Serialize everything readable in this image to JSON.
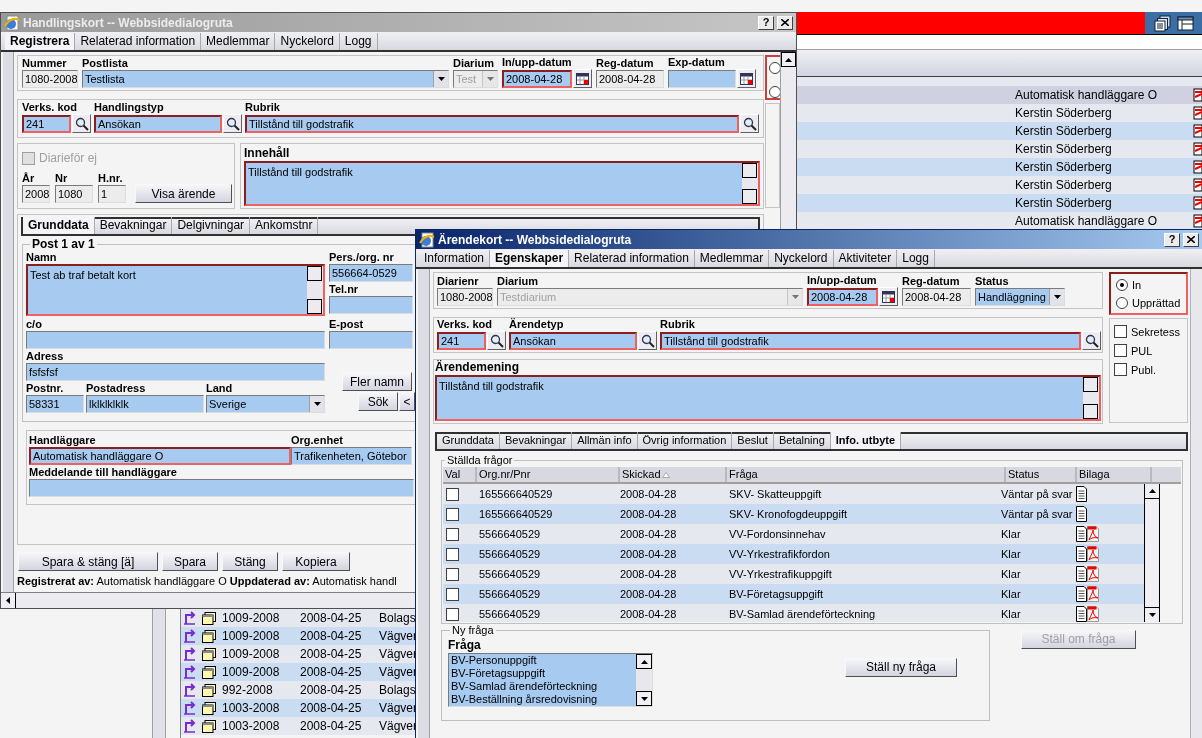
{
  "handler_list": {
    "rows": [
      {
        "name": "Automatisk handläggare O",
        "selected": true
      },
      {
        "name": "Kerstin Söderberg",
        "selected": false
      },
      {
        "name": "Kerstin Söderberg",
        "selected": false
      },
      {
        "name": "Kerstin Söderberg",
        "selected": false
      },
      {
        "name": "Kerstin Söderberg",
        "selected": false
      },
      {
        "name": "Kerstin Söderberg",
        "selected": false
      },
      {
        "name": "Kerstin Söderberg",
        "selected": false
      },
      {
        "name": "Automatisk handläggare O",
        "selected": false
      }
    ]
  },
  "case_list": {
    "rows": [
      {
        "case_number": "1009-2008",
        "date": "2008-04-25",
        "column_3": "Bolags"
      },
      {
        "case_number": "1009-2008",
        "date": "2008-04-25",
        "column_3": "Vägver"
      },
      {
        "case_number": "1009-2008",
        "date": "2008-04-25",
        "column_3": "Vägver"
      },
      {
        "case_number": "1009-2008",
        "date": "2008-04-25",
        "column_3": "Vägver"
      },
      {
        "case_number": "992-2008",
        "date": "2008-04-25",
        "column_3": "Bolags"
      },
      {
        "case_number": "1003-2008",
        "date": "2008-04-25",
        "column_3": "Vägver"
      },
      {
        "case_number": "1003-2008",
        "date": "2008-04-25",
        "column_3": "Vägver"
      }
    ]
  },
  "handlingskort": {
    "title": "Handlingskort -- Webbsidedialogruta",
    "help": "?",
    "tabs": [
      {
        "label": "Registrera",
        "selected": true
      },
      {
        "label": "Relaterad information",
        "selected": false
      },
      {
        "label": "Medlemmar",
        "selected": false
      },
      {
        "label": "Nyckelord",
        "selected": false
      },
      {
        "label": "Logg",
        "selected": false
      }
    ],
    "header_fields": [
      {
        "label": "Nummer",
        "value": "1080-2008",
        "kind": "readonly",
        "required": false
      },
      {
        "label": "Postlista",
        "value": "Testlista",
        "kind": "select",
        "required": false
      },
      {
        "label": "Diarium",
        "value": "Test",
        "kind": "disabled-select",
        "required": false
      },
      {
        "label": "In/upp-datum",
        "value": "2008-04-28",
        "kind": "date",
        "required": true
      },
      {
        "label": "Reg-datum",
        "value": "2008-04-28",
        "kind": "readonly",
        "required": false
      },
      {
        "label": "Exp-datum",
        "kind": "date",
        "required": false
      }
    ],
    "lookup_fields": [
      {
        "label": "Verks. kod",
        "value": "241",
        "kind": "lookup",
        "required": true
      },
      {
        "label": "Handlingstyp",
        "value": "Ansökan",
        "kind": "lookup",
        "required": true
      },
      {
        "label": "Rubrik",
        "value": "Tillstånd till godstrafik",
        "kind": "lookup",
        "required": true
      }
    ],
    "no_register": {
      "label": "Diarieför ej",
      "checked": false,
      "disabled": true
    },
    "number_fields": [
      {
        "label": "År",
        "value": "2008",
        "kind": "readonly",
        "required": false
      },
      {
        "label": "Nr",
        "value": "1080",
        "kind": "readonly",
        "required": false
      },
      {
        "label": "H.nr.",
        "value": "1",
        "kind": "readonly",
        "required": false
      }
    ],
    "show_case_button": "Visa ärende",
    "content": {
      "label": "Innehåll",
      "value": "Tillstånd till godstrafik",
      "kind": "textarea",
      "required": true
    },
    "sub_tabs": [
      {
        "label": "Grunddata",
        "selected": true
      },
      {
        "label": "Bevakningar",
        "selected": false
      },
      {
        "label": "Delgivningar",
        "selected": false
      },
      {
        "label": "Ankomstnr",
        "selected": false
      }
    ],
    "post": {
      "legend": "Post 1 av 1",
      "name": {
        "label": "Namn",
        "value": "Test ab traf betalt kort",
        "kind": "textarea",
        "required": true
      },
      "org_nr": {
        "label": "Pers./org. nr",
        "value": "556664-0529",
        "kind": "text",
        "required": false
      },
      "phone": {
        "label": "Tel.nr",
        "kind": "text",
        "required": false
      },
      "co": {
        "label": "c/o",
        "kind": "text",
        "required": false
      },
      "email": {
        "label": "E-post",
        "kind": "text",
        "required": false
      },
      "address": {
        "label": "Adress",
        "value": "fsfsfsf",
        "kind": "text",
        "required": false
      },
      "postal_code": {
        "label": "Postnr.",
        "value": "58331",
        "kind": "text",
        "required": false
      },
      "city": {
        "label": "Postadress",
        "value": "lklklklklk",
        "kind": "text",
        "required": false
      },
      "country": {
        "label": "Land",
        "value": "Sverige",
        "kind": "select",
        "required": false
      },
      "more_names_button": "Fler namn",
      "search_button": "Sök",
      "previous_button": "<"
    },
    "handler": {
      "label": "Handläggare",
      "value": "Automatisk handläggare O",
      "kind": "text",
      "required": true
    },
    "org_unit": {
      "label": "Org.enhet",
      "value": "Trafikenheten, Götebor",
      "kind": "text",
      "required": false
    },
    "message": {
      "label": "Meddelande till handläggare",
      "kind": "text",
      "required": false
    },
    "buttons": [
      "Spara & stäng [ä]",
      "Spara",
      "Stäng",
      "Kopiera"
    ],
    "footer": "**Registrerat av:** Automatisk handläggare O **Uppdaterad av:** Automatisk handl",
    "side_panel": {
      "radios": [
        {
          "selected": false
        },
        {
          "selected": false
        }
      ]
    }
  },
  "arendekort": {
    "title": "Ärendekort -- Webbsidedialogruta",
    "help": "?",
    "tabs": [
      {
        "label": "Information",
        "selected": false
      },
      {
        "label": "Egenskaper",
        "selected": true
      },
      {
        "label": "Relaterad information",
        "selected": false
      },
      {
        "label": "Medlemmar",
        "selected": false
      },
      {
        "label": "Nyckelord",
        "selected": false
      },
      {
        "label": "Aktiviteter",
        "selected": false
      },
      {
        "label": "Logg",
        "selected": false
      }
    ],
    "header_fields": [
      {
        "label": "Diarienr",
        "value": "1080-2008",
        "kind": "readonly",
        "required": false
      },
      {
        "label": "Diarium",
        "value": "Testdiarium",
        "kind": "disabled-select",
        "required": false
      },
      {
        "label": "In/upp-datum",
        "value": "2008-04-28",
        "kind": "date",
        "required": true
      },
      {
        "label": "Reg-datum",
        "value": "2008-04-28",
        "kind": "readonly",
        "required": false
      },
      {
        "label": "Status",
        "value": "Handläggning",
        "kind": "select",
        "required": false
      }
    ],
    "direction": [
      {
        "label": "In",
        "selected": true
      },
      {
        "label": "Upprättad",
        "selected": false
      }
    ],
    "flags": [
      {
        "label": "Sekretess",
        "checked": false
      },
      {
        "label": "PUL",
        "checked": false
      },
      {
        "label": "Publ.",
        "checked": false
      }
    ],
    "lookup_fields": [
      {
        "label": "Verks. kod",
        "value": "241",
        "kind": "lookup",
        "required": true
      },
      {
        "label": "Ärendetyp",
        "value": "Ansökan",
        "kind": "lookup",
        "required": true
      },
      {
        "label": "Rubrik",
        "value": "Tillstånd till godstrafik",
        "kind": "lookup",
        "required": true
      }
    ],
    "description": {
      "label": "Ärendemening",
      "value": "Tillstånd till godstrafik",
      "kind": "textarea",
      "required": true
    },
    "sub_tabs": [
      {
        "label": "Grunddata",
        "selected": false
      },
      {
        "label": "Bevakningar",
        "selected": false
      },
      {
        "label": "Allmän info",
        "selected": false
      },
      {
        "label": "Övrig information",
        "selected": false
      },
      {
        "label": "Beslut",
        "selected": false
      },
      {
        "label": "Betalning",
        "selected": false
      },
      {
        "label": "Info. utbyte",
        "selected": true
      }
    ],
    "questions": {
      "legend": "Ställda frågor",
      "columns": [
        "Val",
        "Org.nr/Pnr",
        "Skickad",
        "Fråga",
        "Status",
        "Bilaga"
      ],
      "rows": [
        {
          "checked": false,
          "org_nr": "165566640529",
          "sent": "2008-04-28",
          "question": "SKV- Skatteuppgift",
          "status": "Väntar på svar",
          "has_pdf": false
        },
        {
          "checked": false,
          "org_nr": "165566640529",
          "sent": "2008-04-28",
          "question": "SKV- Kronofogdeuppgift",
          "status": "Väntar på svar",
          "has_pdf": false
        },
        {
          "checked": false,
          "org_nr": "5566640529",
          "sent": "2008-04-28",
          "question": "VV-Fordonsinnehav",
          "status": "Klar",
          "has_pdf": true
        },
        {
          "checked": false,
          "org_nr": "5566640529",
          "sent": "2008-04-28",
          "question": "VV-Yrkestrafikfordon",
          "status": "Klar",
          "has_pdf": true
        },
        {
          "checked": false,
          "org_nr": "5566640529",
          "sent": "2008-04-28",
          "question": "VV-Yrkestrafikuppgift",
          "status": "Klar",
          "has_pdf": true
        },
        {
          "checked": false,
          "org_nr": "5566640529",
          "sent": "2008-04-28",
          "question": "BV-Företagsuppgift",
          "status": "Klar",
          "has_pdf": true
        },
        {
          "checked": false,
          "org_nr": "5566640529",
          "sent": "2008-04-28",
          "question": "BV-Samlad ärendeförteckning",
          "status": "Klar",
          "has_pdf": true
        }
      ]
    },
    "new_question": {
      "legend": "Ny fråga",
      "label": "Fråga",
      "options": [
        "BV-Personuppgift",
        "BV-Företagsuppgift",
        "BV-Samlad ärendeförteckning",
        "BV-Beställning årsredovisning"
      ]
    },
    "ask_new_button": {
      "label": "Ställ ny fråga",
      "disabled": false
    },
    "ask_again_button": {
      "label": "Ställ om fråga",
      "disabled": true
    }
  }
}
